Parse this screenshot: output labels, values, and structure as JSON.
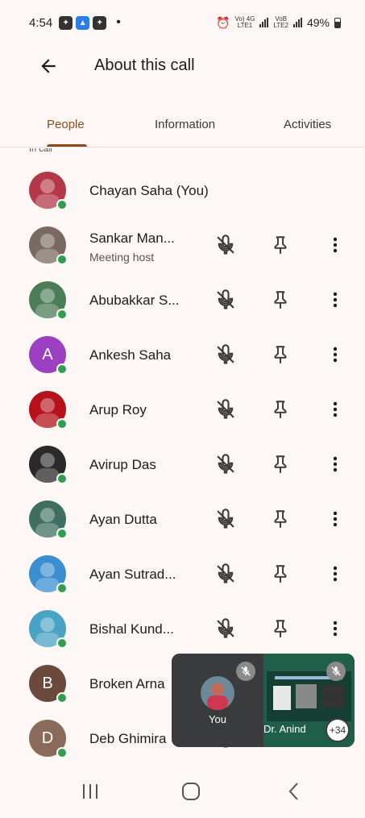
{
  "status_bar": {
    "time": "4:54",
    "net1_top": "Vo) 4G",
    "net1_bottom": "LTE1",
    "net2_top": "VoB",
    "net2_bottom": "LTE2",
    "battery": "49%",
    "dot": "•"
  },
  "app_bar": {
    "title": "About this call"
  },
  "tabs": [
    {
      "label": "People"
    },
    {
      "label": "Information"
    },
    {
      "label": "Activities"
    }
  ],
  "section_label": "In call",
  "participants": [
    {
      "name": "Chayan Saha (You)",
      "subtitle": "",
      "initial": "",
      "avatar_color": "#b5384a",
      "has_controls": false
    },
    {
      "name": "Sankar Man...",
      "subtitle": "Meeting host",
      "initial": "",
      "avatar_color": "#7a6a62",
      "has_controls": true
    },
    {
      "name": "Abubakkar S...",
      "subtitle": "",
      "initial": "",
      "avatar_color": "#4c7d59",
      "has_controls": true
    },
    {
      "name": "Ankesh Saha",
      "subtitle": "",
      "initial": "A",
      "avatar_color": "#9c3fc0",
      "has_controls": true
    },
    {
      "name": "Arup Roy",
      "subtitle": "",
      "initial": "",
      "avatar_color": "#b5121b",
      "has_controls": true
    },
    {
      "name": "Avirup Das",
      "subtitle": "",
      "initial": "",
      "avatar_color": "#2a2a2a",
      "has_controls": true
    },
    {
      "name": "Ayan Dutta",
      "subtitle": "",
      "initial": "",
      "avatar_color": "#3e6f60",
      "has_controls": true
    },
    {
      "name": "Ayan Sutrad...",
      "subtitle": "",
      "initial": "",
      "avatar_color": "#3b8fd1",
      "has_controls": true
    },
    {
      "name": "Bishal Kund...",
      "subtitle": "",
      "initial": "",
      "avatar_color": "#4aa3c4",
      "has_controls": true
    },
    {
      "name": "Broken Arna",
      "subtitle": "",
      "initial": "B",
      "avatar_color": "#6b4a3d",
      "has_controls": true
    },
    {
      "name": "Deb Ghimira",
      "subtitle": "",
      "initial": "D",
      "avatar_color": "#8a6a5a",
      "has_controls": true
    }
  ],
  "pip": {
    "self_label": "You",
    "share_label": "Dr. Anind",
    "more_count": "+34"
  },
  "colors": {
    "accent": "#8a4d1a",
    "background": "#fdf8f6",
    "online": "#2e9e4f"
  }
}
